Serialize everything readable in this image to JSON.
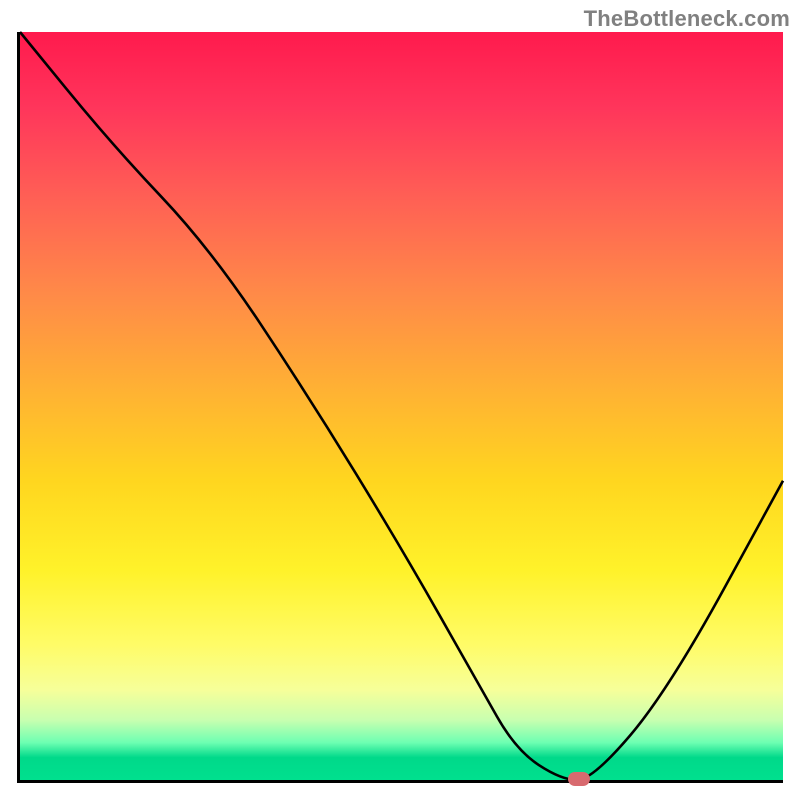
{
  "watermark": "TheBottleneck.com",
  "colors": {
    "gradient_top": "#ff1a4d",
    "gradient_mid": "#ffd61f",
    "gradient_bottom": "#00e08e",
    "curve": "#000000",
    "axis": "#000000",
    "marker": "#d86a6f",
    "watermark_text": "#808080"
  },
  "chart_data": {
    "type": "line",
    "title": "",
    "xlabel": "",
    "ylabel": "",
    "xlim": [
      0,
      100
    ],
    "ylim": [
      0,
      100
    ],
    "x": [
      0,
      12,
      25,
      38,
      50,
      60,
      65,
      71,
      75,
      85,
      100
    ],
    "values": [
      100,
      85,
      71,
      51,
      31,
      13,
      4,
      0,
      0,
      12,
      40
    ],
    "optimum_x": 73,
    "accent_band_start_y": 0,
    "accent_band_end_y": 3
  }
}
